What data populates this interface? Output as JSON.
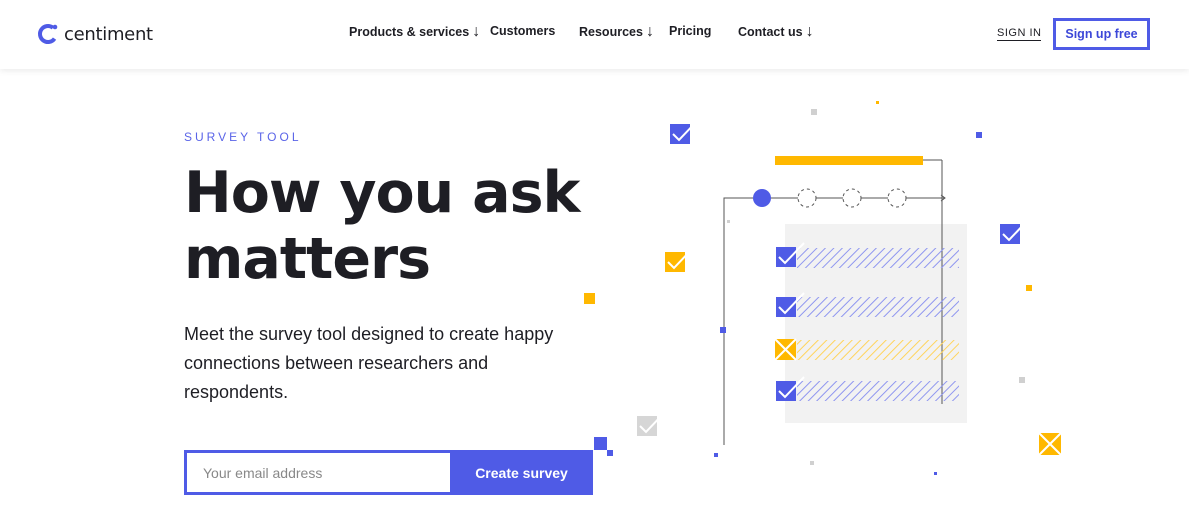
{
  "brand": {
    "name": "centiment",
    "accent": "#4f5be6",
    "highlight": "#ffb800"
  },
  "nav": {
    "items": [
      {
        "label": "Products & services",
        "has_arrow": true
      },
      {
        "label": "Customers",
        "has_arrow": false
      },
      {
        "label": "Resources",
        "has_arrow": true
      },
      {
        "label": "Pricing",
        "has_arrow": false
      },
      {
        "label": "Contact us",
        "has_arrow": true
      }
    ],
    "arrow_glyph": "↓"
  },
  "auth": {
    "signin_label": "SIGN IN",
    "signup_label": "Sign up free"
  },
  "hero": {
    "eyebrow": "SURVEY TOOL",
    "headline_line1": "How you ask",
    "headline_line2": "matters",
    "lead": "Meet the survey tool designed to create happy connections between researchers and respondents.",
    "email_placeholder": "Your email address",
    "cta_label": "Create survey"
  },
  "illustration": {
    "icon_names": [
      "checkbox-checked-icon",
      "checkbox-x-icon",
      "progress-steps-icon"
    ]
  }
}
